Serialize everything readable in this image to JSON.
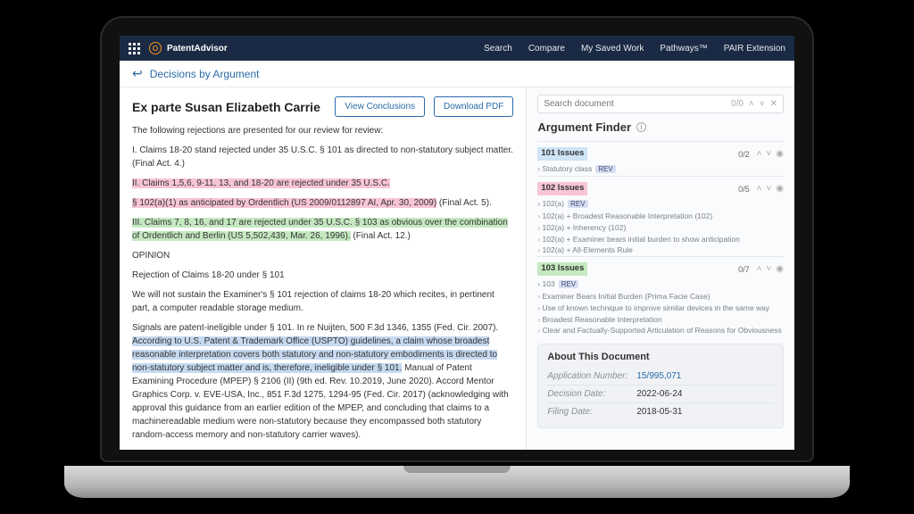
{
  "brand": "PatentAdvisor",
  "nav": {
    "items": [
      "Search",
      "Compare",
      "My Saved Work",
      "Pathways™",
      "PAIR Extension"
    ]
  },
  "breadcrumb": "Decisions by Argument",
  "doc": {
    "title": "Ex parte Susan Elizabeth Carrie",
    "btn_conclusions": "View Conclusions",
    "btn_download": "Download PDF",
    "p_intro": "The following rejections are presented for our review for review:",
    "p_i": "I. Claims 18-20 stand rejected under 35 U.S.C. § 101 as directed to non-statutory subject matter. (Final Act. 4.)",
    "p_ii_a": "II. Claims 1,5,6, 9-11, 13, and 18-20 are rejected under 35 U.S.C.",
    "p_ii_b": "§ 102(a)(1) as anticipated by Ordentlich (US 2009/0112897 AI, Apr. 30, 2009)",
    "p_ii_c": " (Final Act. 5).",
    "p_iii_a": "III. Claims 7, 8, 16, and 17 are rejected under 35 U.S.C. § 103 as obvious over the combination of Ordentlich and Berlin (US 5,502,439, Mar. 26, 1996).",
    "p_iii_b": " (Final Act. 12.)",
    "p_opinion": "OPINION",
    "p_rej": "Rejection of Claims 18-20 under § 101",
    "p_sustain": "We will not sustain the Examiner's § 101 rejection of claims 18-20 which recites, in pertinent part, a computer readable storage medium.",
    "p_signals_pre": "Signals are patent-ineligible under § 101. In re Nuijten, 500 F.3d 1346, 1355 (Fed. Cir. 2007). ",
    "p_signals_hl": "According to U.S. Patent & Trademark Office (USPTO) guidelines, a claim whose broadest reasonable interpretation covers both statutory and non-statutory embodiments is directed to non-statutory subject matter and is, therefore, ineligible under § 101.",
    "p_signals_post": " Manual of Patent Examining Procedure (MPEP) § 2106 (II) (9th ed. Rev. 10.2019, June 2020). Accord Mentor Graphics Corp. v. EVE-USA, Inc., 851 F.3d 1275, 1294-95 (Fed. Cir. 2017) (acknowledging with approval this guidance from an earlier edition of the MPEP, and concluding that claims to a machinereadable medium were non-statutory because they encompassed both statutory random-access memory and non-statutory carrier waves)."
  },
  "search": {
    "placeholder": "Search document",
    "count": "0/0"
  },
  "finder": {
    "title": "Argument Finder",
    "groups": [
      {
        "key": "101",
        "label": "101 Issues",
        "count": "0/2",
        "first": "Statutory class",
        "first_tag": "REV",
        "items": []
      },
      {
        "key": "102",
        "label": "102 Issues",
        "count": "0/5",
        "first": "102(a)",
        "first_tag": "REV",
        "items": [
          "102(a) + Broadest Reasonable Interpretation (102)",
          "102(a) + Inherency (102)",
          "102(a) + Examiner bears initial burden to show anticipation",
          "102(a) + All-Elements Rule"
        ]
      },
      {
        "key": "103",
        "label": "103 Issues",
        "count": "0/7",
        "first": "103",
        "first_tag": "REV",
        "items": [
          "Examiner Bears Initial Burden (Prima Facie Case)",
          "Use of known technique to improve similar devices in the same way",
          "Broadest Reasonable Interpretation",
          "Clear and Factually-Supported Articulation of Reasons for Obviousness"
        ]
      }
    ]
  },
  "about": {
    "title": "About This Document",
    "rows": [
      {
        "label": "Application Number:",
        "value": "15/995,071",
        "link": true
      },
      {
        "label": "Decision Date:",
        "value": "2022-06-24",
        "link": false
      },
      {
        "label": "Filing Date:",
        "value": "2018-05-31",
        "link": false
      }
    ]
  }
}
